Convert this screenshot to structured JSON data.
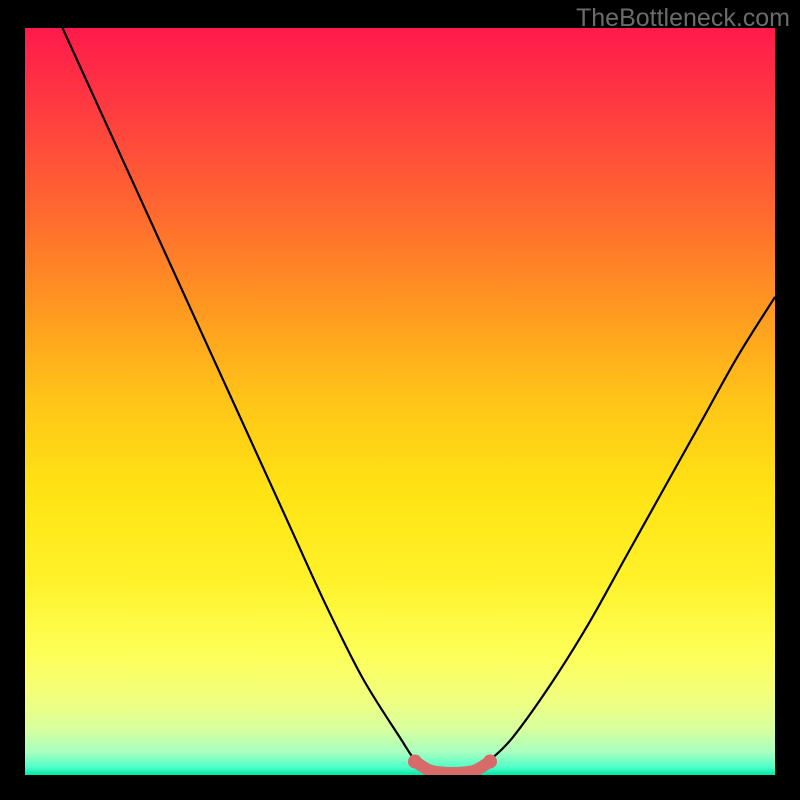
{
  "watermark": "TheBottleneck.com",
  "chart_data": {
    "type": "line",
    "title": "",
    "xlabel": "",
    "ylabel": "",
    "xlim": [
      0,
      100
    ],
    "ylim": [
      0,
      100
    ],
    "series": [
      {
        "name": "bottleneck-curve",
        "x": [
          5,
          10,
          15,
          20,
          25,
          30,
          35,
          40,
          45,
          50,
          52,
          54,
          56,
          58,
          60,
          62,
          65,
          70,
          75,
          80,
          85,
          90,
          95,
          100
        ],
        "y": [
          100,
          89,
          78,
          67,
          56,
          45,
          34,
          23,
          13,
          5,
          2,
          0.5,
          0.2,
          0.2,
          0.5,
          2,
          5,
          12,
          20,
          29,
          38,
          47,
          56,
          64
        ]
      },
      {
        "name": "optimal-range-marker",
        "x": [
          52,
          54,
          56,
          58,
          60,
          62
        ],
        "y": [
          1.8,
          0.6,
          0.3,
          0.3,
          0.6,
          1.8
        ]
      }
    ],
    "gradient_stops": [
      {
        "pos": 0,
        "color": "#ff1a4c"
      },
      {
        "pos": 50,
        "color": "#ffc518"
      },
      {
        "pos": 85,
        "color": "#fdff59"
      },
      {
        "pos": 100,
        "color": "#00e6a8"
      }
    ]
  }
}
